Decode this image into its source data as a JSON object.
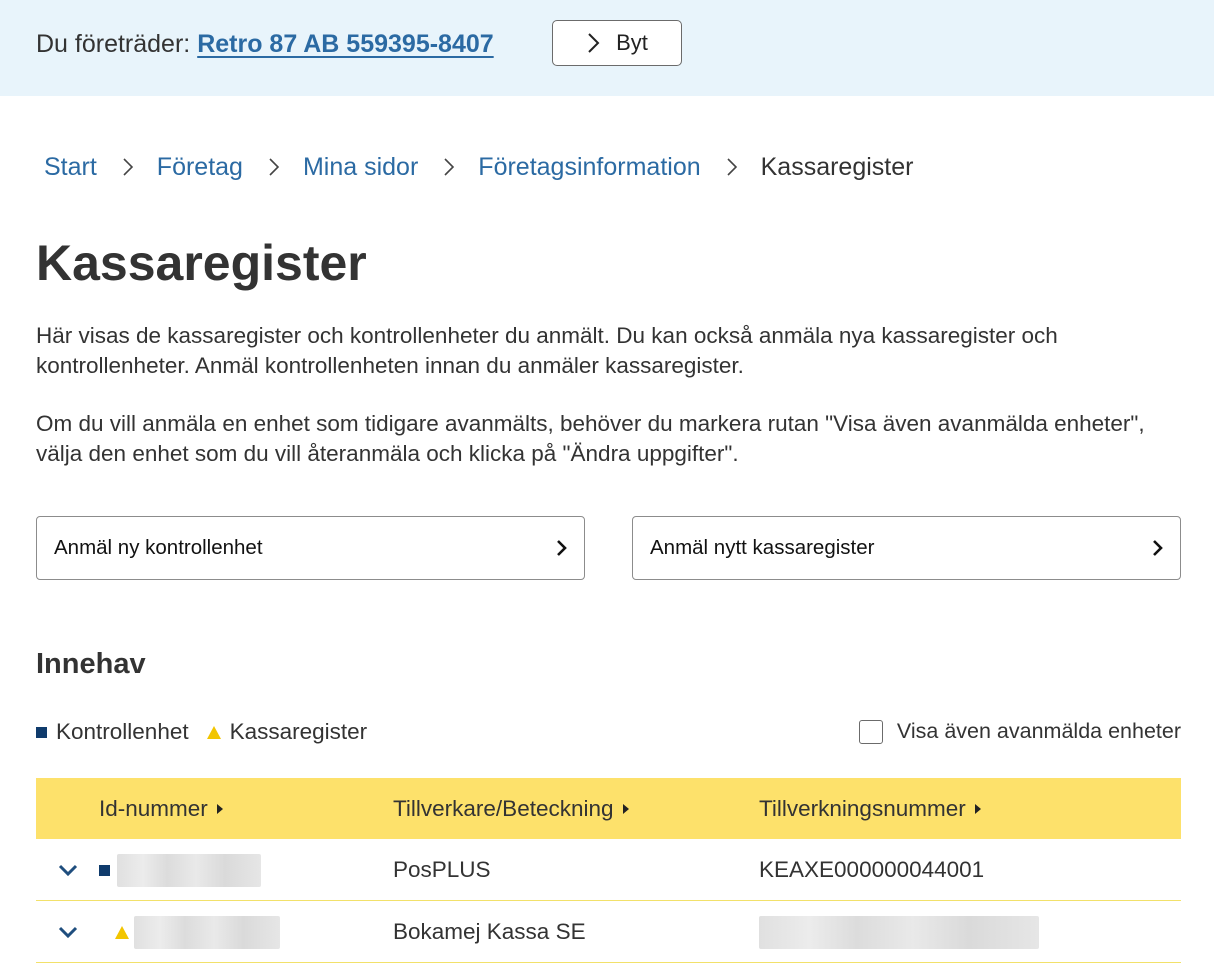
{
  "representative": {
    "label": "Du företräder:",
    "company": "Retro 87 AB 559395-8407",
    "switch_button": "Byt"
  },
  "breadcrumb": {
    "items": [
      "Start",
      "Företag",
      "Mina sidor",
      "Företagsinformation"
    ],
    "current": "Kassaregister"
  },
  "page": {
    "title": "Kassaregister",
    "intro_1": "Här visas de kassaregister och kontrollenheter du anmält. Du kan också anmäla nya kassaregister och kontrollenheter. Anmäl kontrollenheten innan du anmäler kassaregister.",
    "intro_2": "Om du vill anmäla en enhet som tidigare avanmälts, behöver du markera rutan \"Visa även avanmälda enheter\", välja den enhet som du vill återanmäla och klicka på \"Ändra uppgifter\"."
  },
  "actions": {
    "new_control_unit": "Anmäl ny kontrollenhet",
    "new_cash_register": "Anmäl nytt kassaregister"
  },
  "holdings": {
    "title": "Innehav",
    "legend": {
      "control_unit": "Kontrollenhet",
      "cash_register": "Kassaregister"
    },
    "show_deregistered_label": "Visa även avanmälda enheter",
    "show_deregistered_checked": false,
    "columns": [
      "Id-nummer",
      "Tillverkare/Beteckning",
      "Tillverkningsnummer"
    ],
    "rows": [
      {
        "type": "control_unit",
        "id": "",
        "manufacturer": "PosPLUS",
        "serial": "KEAXE000000044001"
      },
      {
        "type": "cash_register",
        "id": "",
        "manufacturer": "Bokamej Kassa SE",
        "serial": ""
      }
    ]
  },
  "colors": {
    "link": "#2b6aa3",
    "header_band": "#e8f4fb",
    "table_header": "#fde16b",
    "control_unit_marker": "#0f3b6c",
    "cash_register_marker": "#f2c500"
  }
}
